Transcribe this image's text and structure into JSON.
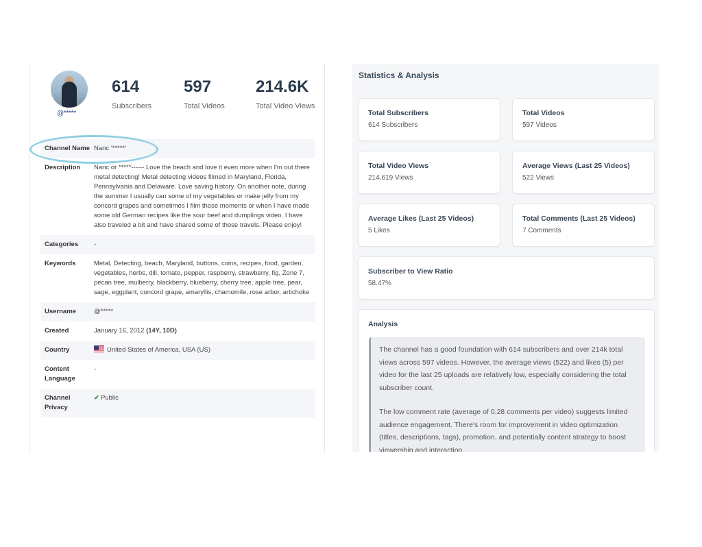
{
  "profile": {
    "handle": "@*****",
    "stats": [
      {
        "value": "614",
        "label": "Subscribers"
      },
      {
        "value": "597",
        "label": "Total Videos"
      },
      {
        "value": "214.6K",
        "label": "Total Video Views"
      }
    ]
  },
  "details": {
    "channel_name": {
      "key": "Channel Name",
      "value": "Nanc '*****'"
    },
    "description": {
      "key": "Description",
      "value": "Nanc or *****------ Love the beach and love it even more when I'm out there metal detecting! Metal detecting videos filmed in Maryland, Florida, Pennsylvania and Delaware. Love saving history. On another note, during the summer I usually can some of my vegetables or make jelly from my concord grapes and sometimes I film those moments or when I have made some old German recipes like the sour beef and dumplings video. I have also traveled a bit and have shared some of those travels. Please enjoy!"
    },
    "categories": {
      "key": "Categories",
      "value": "-"
    },
    "keywords": {
      "key": "Keywords",
      "value": "Metal, Detecting, beach, Maryland, buttons, coins, recipes, food, garden, vegetables, herbs, dill, tomato, pepper, raspberry, strawberry, fig, Zone 7, pecan tree, mulberry, blackberry, blueberry, cherry tree, apple tree, pear, sage, eggplant, concord grape, amaryllis, chamomile, rose arbor, artichoke"
    },
    "username": {
      "key": "Username",
      "value": "@*****"
    },
    "created": {
      "key": "Created",
      "value": "January 16, 2012",
      "age": "(14Y, 10D)"
    },
    "country": {
      "key": "Country",
      "value": "United States of America, USA (US)"
    },
    "content_language": {
      "key": "Content Language",
      "value": "-"
    },
    "channel_privacy": {
      "key": "Channel Privacy",
      "value": "Public"
    }
  },
  "statistics": {
    "title": "Statistics & Analysis",
    "cards": [
      {
        "title": "Total Subscribers",
        "value": "614 Subscribers"
      },
      {
        "title": "Total Videos",
        "value": "597 Videos"
      },
      {
        "title": "Total Video Views",
        "value": "214,619 Views"
      },
      {
        "title": "Average Views (Last 25 Videos)",
        "value": "522 Views"
      },
      {
        "title": "Average Likes (Last 25 Videos)",
        "value": "5 Likes"
      },
      {
        "title": "Total Comments (Last 25 Videos)",
        "value": "7 Comments"
      },
      {
        "title": "Subscriber to View Ratio",
        "value": "58.47%"
      }
    ],
    "analysis": {
      "title": "Analysis",
      "paragraphs": [
        "The channel has a good foundation with 614 subscribers and over 214k total views across 597 videos. However, the average views (522) and likes (5) per video for the last 25 uploads are relatively low, especially considering the total subscriber count.",
        "The low comment rate (average of 0.28 comments per video) suggests limited audience engagement. There's room for improvement in video optimization (titles, descriptions, tags), promotion, and potentially content strategy to boost viewership and interaction."
      ]
    }
  },
  "colors": {
    "highlight": "#8fd0e2",
    "link": "#2b4a8c",
    "check": "#2e9a44"
  }
}
